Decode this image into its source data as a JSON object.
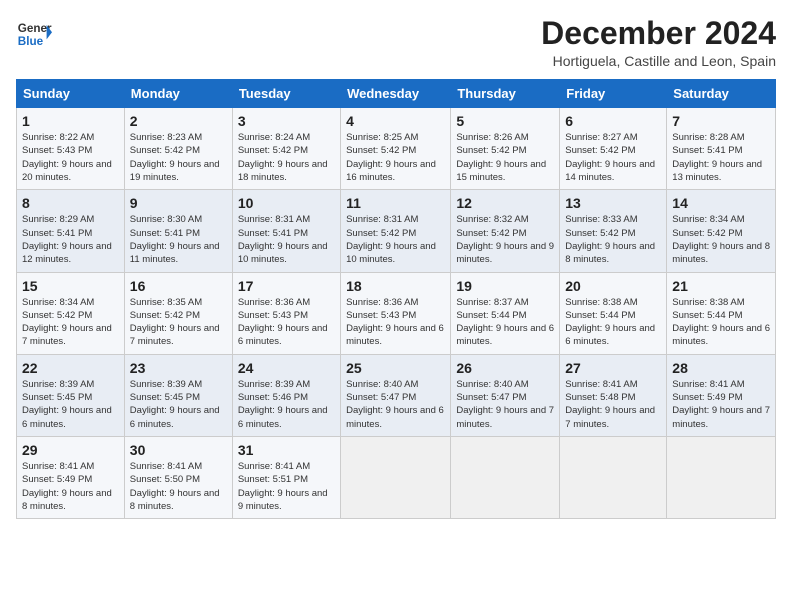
{
  "header": {
    "logo_general": "General",
    "logo_blue": "Blue",
    "title": "December 2024",
    "subtitle": "Hortiguela, Castille and Leon, Spain"
  },
  "columns": [
    "Sunday",
    "Monday",
    "Tuesday",
    "Wednesday",
    "Thursday",
    "Friday",
    "Saturday"
  ],
  "weeks": [
    [
      {
        "day": "1",
        "sunrise": "8:22 AM",
        "sunset": "5:43 PM",
        "daylight": "9 hours and 20 minutes."
      },
      {
        "day": "2",
        "sunrise": "8:23 AM",
        "sunset": "5:42 PM",
        "daylight": "9 hours and 19 minutes."
      },
      {
        "day": "3",
        "sunrise": "8:24 AM",
        "sunset": "5:42 PM",
        "daylight": "9 hours and 18 minutes."
      },
      {
        "day": "4",
        "sunrise": "8:25 AM",
        "sunset": "5:42 PM",
        "daylight": "9 hours and 16 minutes."
      },
      {
        "day": "5",
        "sunrise": "8:26 AM",
        "sunset": "5:42 PM",
        "daylight": "9 hours and 15 minutes."
      },
      {
        "day": "6",
        "sunrise": "8:27 AM",
        "sunset": "5:42 PM",
        "daylight": "9 hours and 14 minutes."
      },
      {
        "day": "7",
        "sunrise": "8:28 AM",
        "sunset": "5:41 PM",
        "daylight": "9 hours and 13 minutes."
      }
    ],
    [
      {
        "day": "8",
        "sunrise": "8:29 AM",
        "sunset": "5:41 PM",
        "daylight": "9 hours and 12 minutes."
      },
      {
        "day": "9",
        "sunrise": "8:30 AM",
        "sunset": "5:41 PM",
        "daylight": "9 hours and 11 minutes."
      },
      {
        "day": "10",
        "sunrise": "8:31 AM",
        "sunset": "5:41 PM",
        "daylight": "9 hours and 10 minutes."
      },
      {
        "day": "11",
        "sunrise": "8:31 AM",
        "sunset": "5:42 PM",
        "daylight": "9 hours and 10 minutes."
      },
      {
        "day": "12",
        "sunrise": "8:32 AM",
        "sunset": "5:42 PM",
        "daylight": "9 hours and 9 minutes."
      },
      {
        "day": "13",
        "sunrise": "8:33 AM",
        "sunset": "5:42 PM",
        "daylight": "9 hours and 8 minutes."
      },
      {
        "day": "14",
        "sunrise": "8:34 AM",
        "sunset": "5:42 PM",
        "daylight": "9 hours and 8 minutes."
      }
    ],
    [
      {
        "day": "15",
        "sunrise": "8:34 AM",
        "sunset": "5:42 PM",
        "daylight": "9 hours and 7 minutes."
      },
      {
        "day": "16",
        "sunrise": "8:35 AM",
        "sunset": "5:42 PM",
        "daylight": "9 hours and 7 minutes."
      },
      {
        "day": "17",
        "sunrise": "8:36 AM",
        "sunset": "5:43 PM",
        "daylight": "9 hours and 6 minutes."
      },
      {
        "day": "18",
        "sunrise": "8:36 AM",
        "sunset": "5:43 PM",
        "daylight": "9 hours and 6 minutes."
      },
      {
        "day": "19",
        "sunrise": "8:37 AM",
        "sunset": "5:44 PM",
        "daylight": "9 hours and 6 minutes."
      },
      {
        "day": "20",
        "sunrise": "8:38 AM",
        "sunset": "5:44 PM",
        "daylight": "9 hours and 6 minutes."
      },
      {
        "day": "21",
        "sunrise": "8:38 AM",
        "sunset": "5:44 PM",
        "daylight": "9 hours and 6 minutes."
      }
    ],
    [
      {
        "day": "22",
        "sunrise": "8:39 AM",
        "sunset": "5:45 PM",
        "daylight": "9 hours and 6 minutes."
      },
      {
        "day": "23",
        "sunrise": "8:39 AM",
        "sunset": "5:45 PM",
        "daylight": "9 hours and 6 minutes."
      },
      {
        "day": "24",
        "sunrise": "8:39 AM",
        "sunset": "5:46 PM",
        "daylight": "9 hours and 6 minutes."
      },
      {
        "day": "25",
        "sunrise": "8:40 AM",
        "sunset": "5:47 PM",
        "daylight": "9 hours and 6 minutes."
      },
      {
        "day": "26",
        "sunrise": "8:40 AM",
        "sunset": "5:47 PM",
        "daylight": "9 hours and 7 minutes."
      },
      {
        "day": "27",
        "sunrise": "8:41 AM",
        "sunset": "5:48 PM",
        "daylight": "9 hours and 7 minutes."
      },
      {
        "day": "28",
        "sunrise": "8:41 AM",
        "sunset": "5:49 PM",
        "daylight": "9 hours and 7 minutes."
      }
    ],
    [
      {
        "day": "29",
        "sunrise": "8:41 AM",
        "sunset": "5:49 PM",
        "daylight": "9 hours and 8 minutes."
      },
      {
        "day": "30",
        "sunrise": "8:41 AM",
        "sunset": "5:50 PM",
        "daylight": "9 hours and 8 minutes."
      },
      {
        "day": "31",
        "sunrise": "8:41 AM",
        "sunset": "5:51 PM",
        "daylight": "9 hours and 9 minutes."
      },
      null,
      null,
      null,
      null
    ]
  ],
  "colors": {
    "header_bg": "#1a6cc4",
    "odd_row": "#f5f7fa",
    "even_row": "#e8edf4"
  }
}
